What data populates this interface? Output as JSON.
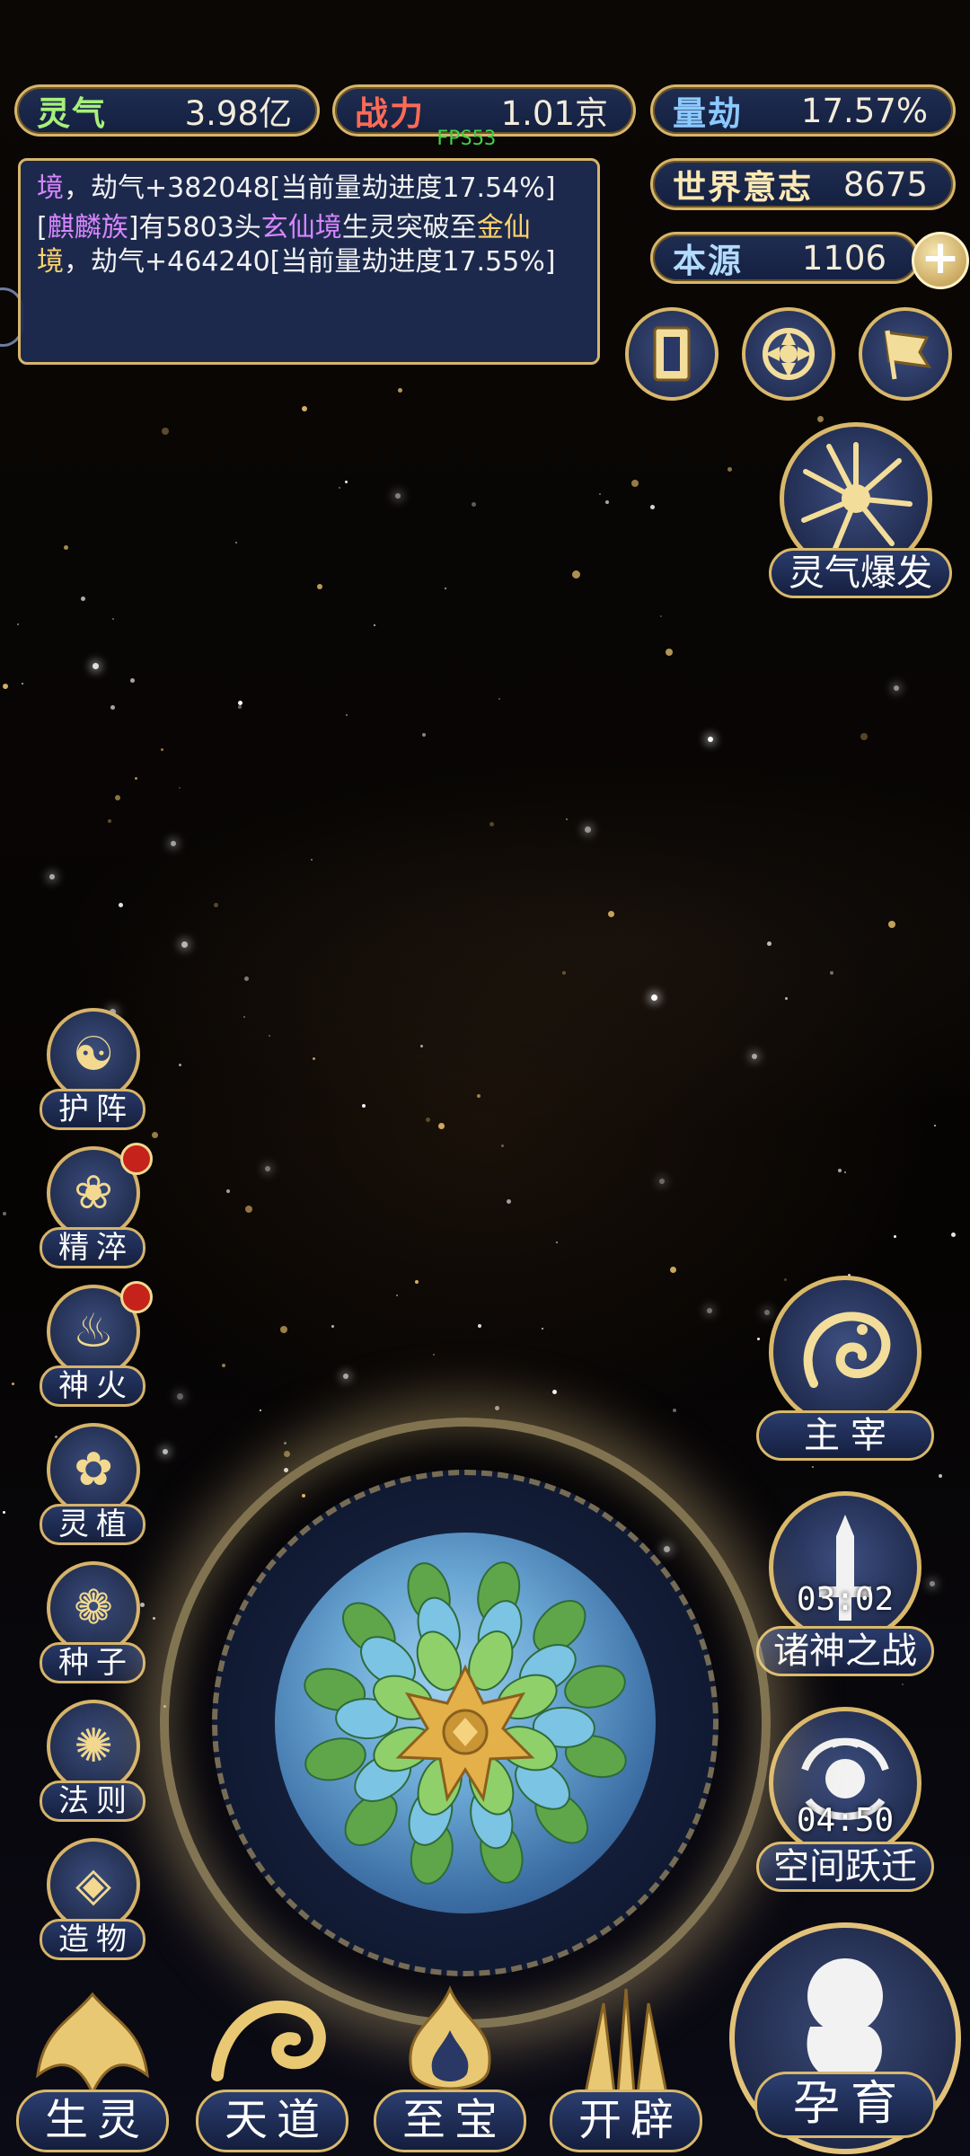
{
  "stats": {
    "lingqi": {
      "label": "灵气",
      "value": "3.98亿"
    },
    "zhanli": {
      "label": "战力",
      "value": "1.01京"
    },
    "liangjie": {
      "label": "量劫",
      "value": "17.57%"
    },
    "shijie": {
      "label": "世界意志",
      "value": "8675"
    },
    "benyuan": {
      "label": "本源",
      "value": "1106"
    }
  },
  "fps": "FPS53",
  "log": {
    "line1": {
      "a": "境",
      "b": "，劫气+382048[当前量劫进度17.54%]"
    },
    "line2": {
      "a": "[",
      "b": "麒麟族",
      "c": "]有5803头",
      "d": "玄仙境",
      "e": "生灵突破至",
      "f": "金仙境",
      "g": "，劫气+464240[当前量劫进度17.55%]"
    }
  },
  "skill": {
    "lingqi_burst": "灵气爆发"
  },
  "left_menu": [
    {
      "label": "护阵",
      "icon": "☯"
    },
    {
      "label": "精淬",
      "icon": "❀"
    },
    {
      "label": "神火",
      "icon": "♨"
    },
    {
      "label": "灵植",
      "icon": "✿"
    },
    {
      "label": "种子",
      "icon": "❁"
    },
    {
      "label": "法则",
      "icon": "✺"
    },
    {
      "label": "造物",
      "icon": "◈"
    }
  ],
  "right_menu": {
    "zhuzai": "主宰",
    "zhushen": {
      "label": "诸神之战",
      "timer": "03:02"
    },
    "kongjian": {
      "label": "空间跃迁",
      "timer": "04:50"
    }
  },
  "bottom": {
    "shengling": "生灵",
    "tiandao": "天道",
    "zhibao": "至宝",
    "kaipi": "开辟",
    "yunyu": "孕育"
  },
  "colors": {
    "gold": "#d7b56a",
    "panel": "#1f2d52",
    "badge": "#c5221b"
  }
}
